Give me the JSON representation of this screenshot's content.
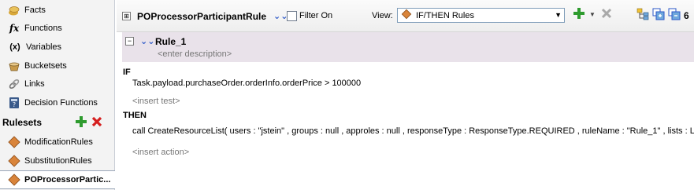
{
  "sidebar": {
    "items": [
      {
        "label": "Facts",
        "icon": "facts-icon"
      },
      {
        "label": "Functions",
        "icon": "function-icon"
      },
      {
        "label": "Variables",
        "icon": "variables-icon"
      },
      {
        "label": "Bucketsets",
        "icon": "bucketsets-icon"
      },
      {
        "label": "Links",
        "icon": "links-icon"
      },
      {
        "label": "Decision Functions",
        "icon": "decision-function-icon"
      }
    ],
    "rulesets_header": "Rulesets",
    "rulesets": [
      {
        "label": "ModificationRules"
      },
      {
        "label": "SubstitutionRules"
      },
      {
        "label": "POProcessorPartic..."
      }
    ]
  },
  "toolbar": {
    "expand_symbol": "⊞",
    "title": "POProcessorParticipantRule",
    "filter_label": "Filter On",
    "view_label": "View:",
    "view_value": "IF/THEN Rules",
    "cut_label": "6"
  },
  "rule": {
    "toggle": "−",
    "name": "Rule_1",
    "description_placeholder": "<enter description>",
    "if_label": "IF",
    "condition": "Task.payload.purchaseOrder.orderInfo.orderPrice  >  100000",
    "insert_test": "<insert test>",
    "then_label": "THEN",
    "action": "call CreateResourceList( users : \"jstein\" , groups : null , approles : null , responseType : ResponseType.REQUIRED , ruleName : \"Rule_1\" , lists : Lists",
    "insert_action": "<insert action>"
  },
  "colors": {
    "accent_green": "#2e9b2e",
    "delete_red": "#d51e1e",
    "rule_header_bg": "#e9e2ea",
    "chevron_blue": "#2b57c7"
  }
}
